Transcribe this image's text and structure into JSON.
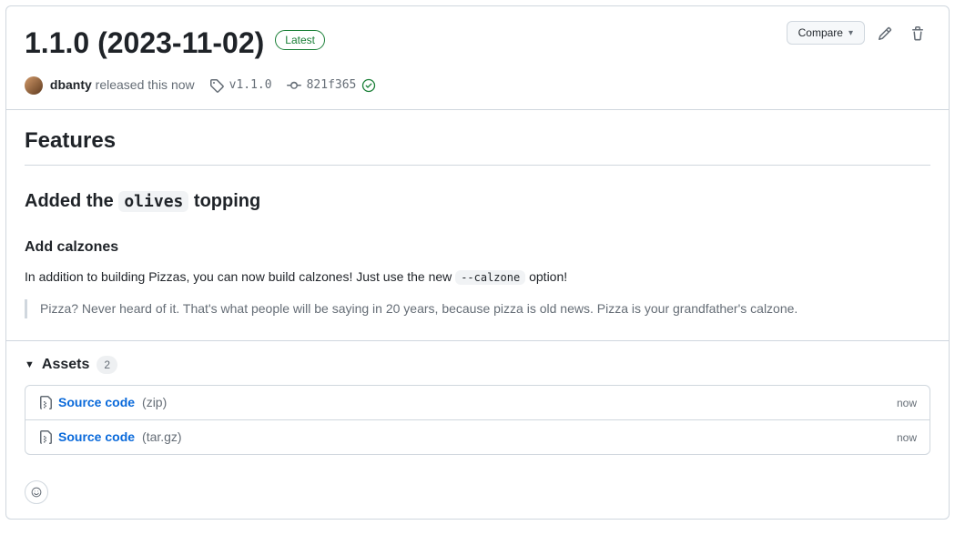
{
  "header": {
    "title": "1.1.0 (2023-11-02)",
    "latest_label": "Latest",
    "compare_label": "Compare"
  },
  "meta": {
    "author": "dbanty",
    "released_text": "released this now",
    "tag": "v1.1.0",
    "commit": "821f365"
  },
  "body": {
    "features_heading": "Features",
    "h3_pre": "Added the ",
    "h3_code": "olives",
    "h3_post": " topping",
    "h4": "Add calzones",
    "p1_pre": "In addition to building Pizzas, you can now build calzones! Just use the new ",
    "p1_code": "--calzone",
    "p1_post": " option!",
    "blockquote": "Pizza? Never heard of it. That's what people will be saying in 20 years, because pizza is old news. Pizza is your grandfather's calzone."
  },
  "assets": {
    "heading": "Assets",
    "count": "2",
    "items": [
      {
        "name": "Source code",
        "ext": "(zip)",
        "time": "now"
      },
      {
        "name": "Source code",
        "ext": "(tar.gz)",
        "time": "now"
      }
    ]
  }
}
